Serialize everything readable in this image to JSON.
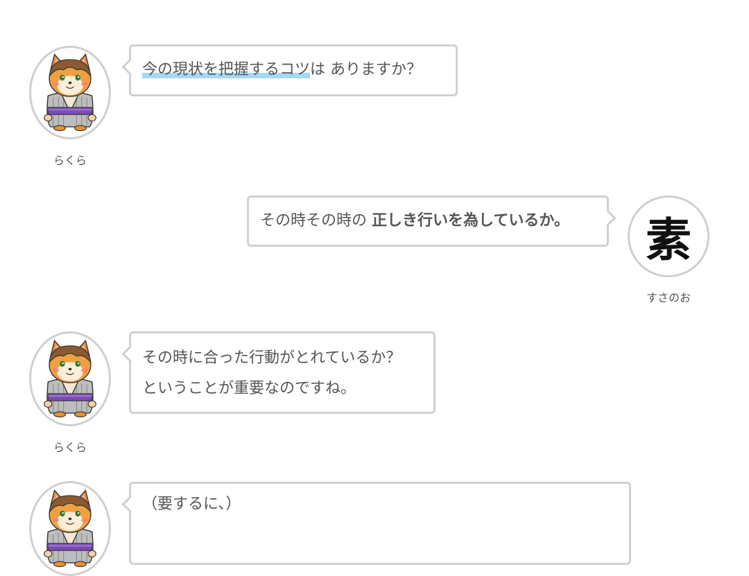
{
  "messages": [
    {
      "speaker": "らくら",
      "side": "left",
      "avatar_icon": "hamster-kimono-icon",
      "lines": [
        {
          "marked": "今の現状を把握するコツ",
          "rest": "は ありますか？"
        }
      ]
    },
    {
      "speaker": "すさのお",
      "side": "right",
      "avatar_icon": "kanji-su-icon",
      "avatar_text": "素",
      "lines": [
        {
          "plain": "その時その時の ",
          "bold": "正しき行いを為しているか。"
        }
      ]
    },
    {
      "speaker": "らくら",
      "side": "left",
      "avatar_icon": "hamster-kimono-icon",
      "lines": [
        {
          "text": "その時に合った行動がとれているか？"
        },
        {
          "text": "ということが重要なのですね。"
        }
      ]
    },
    {
      "speaker": "",
      "side": "left",
      "avatar_icon": "hamster-kimono-icon",
      "lines": [
        {
          "text": "（要するに、）"
        }
      ]
    }
  ],
  "colors": {
    "text": "#555555",
    "bubble_border": "#d0d0d0",
    "avatar_border": "#cfcfcf",
    "marker": "#a7d8f4"
  }
}
